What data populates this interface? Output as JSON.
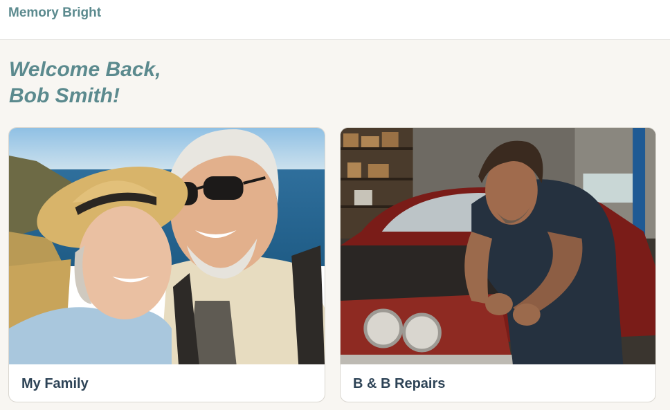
{
  "app": {
    "title": "Memory Bright"
  },
  "welcome": {
    "line1": "Welcome Back,",
    "line2": "Bob Smith!"
  },
  "cards": [
    {
      "label": "My Family",
      "image": "smiling-older-couple-coast-selfie"
    },
    {
      "label": "B & B Repairs",
      "image": "mechanic-working-on-red-classic-car"
    }
  ],
  "colors": {
    "brand": "#5b8a8e",
    "card_label": "#2d4356",
    "background": "#f8f6f2"
  }
}
